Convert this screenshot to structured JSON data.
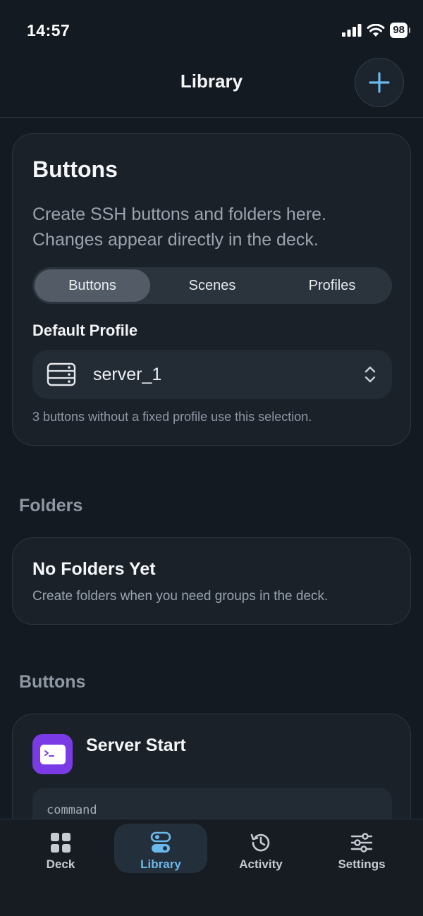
{
  "status": {
    "time": "14:57",
    "battery": "98"
  },
  "nav": {
    "title": "Library"
  },
  "buttons_card": {
    "title": "Buttons",
    "description": "Create SSH buttons and folders here. Changes appear directly in the deck.",
    "segments": [
      "Buttons",
      "Scenes",
      "Profiles"
    ],
    "selected_segment": "Buttons",
    "default_profile_label": "Default Profile",
    "default_profile_value": "server_1",
    "hint": "3 buttons without a fixed profile use this selection."
  },
  "folders": {
    "heading": "Folders",
    "empty_title": "No Folders Yet",
    "empty_desc": "Create folders when you need groups in the deck."
  },
  "buttons_list": {
    "heading": "Buttons",
    "items": [
      {
        "name": "Server Start",
        "command_label": "command"
      }
    ]
  },
  "tabs": [
    {
      "label": "Deck",
      "icon": "grid-icon"
    },
    {
      "label": "Library",
      "icon": "toggles-icon"
    },
    {
      "label": "Activity",
      "icon": "history-icon"
    },
    {
      "label": "Settings",
      "icon": "sliders-icon"
    }
  ],
  "active_tab": "Library",
  "colors": {
    "accent": "#6bb8ec",
    "app_icon": "#7a3be6",
    "background": "#141a21"
  }
}
